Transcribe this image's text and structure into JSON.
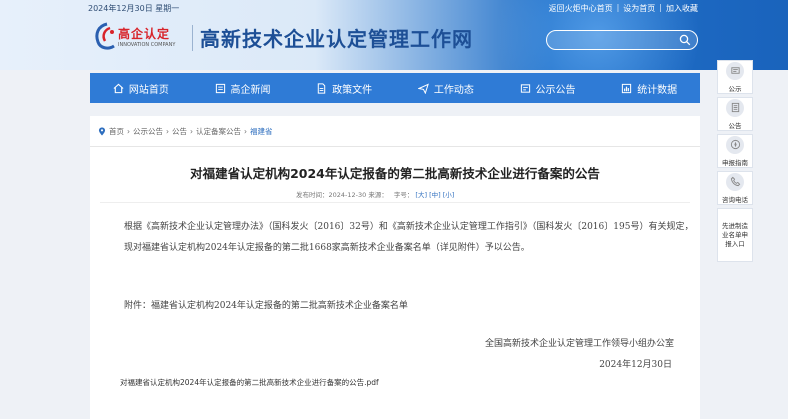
{
  "topbar": {
    "date": "2024年12月30日 星期一",
    "links": [
      "返回火炬中心首页",
      "设为首页",
      "加入收藏"
    ],
    "sep": "|"
  },
  "logo": {
    "cn": "高企认定",
    "en": "INNOVATION COMPANY"
  },
  "site_title": "高新技术企业认定管理工作网",
  "search": {
    "placeholder": ""
  },
  "nav": [
    {
      "label": "网站首页",
      "icon": "home-icon"
    },
    {
      "label": "高企新闻",
      "icon": "news-icon"
    },
    {
      "label": "政策文件",
      "icon": "document-icon"
    },
    {
      "label": "工作动态",
      "icon": "send-icon"
    },
    {
      "label": "公示公告",
      "icon": "notice-icon"
    },
    {
      "label": "统计数据",
      "icon": "chart-icon"
    }
  ],
  "breadcrumb": {
    "items": [
      "首页",
      "公示公告",
      "公告",
      "认定备案公告"
    ],
    "sep": "›",
    "current": "福建省"
  },
  "article": {
    "title": "对福建省认定机构2024年认定报备的第二批高新技术企业进行备案的公告",
    "publish_label": "发布时间：2024-12-30 来源：",
    "size_label": "字号：",
    "size_options": [
      "[大]",
      "[中]",
      "[小]"
    ],
    "paragraph": "根据《高新技术企业认定管理办法》（国科发火〔2016〕32号）和《高新技术企业认定管理工作指引》（国科发火〔2016〕195号）有关规定，现对福建省认定机构2024年认定报备的第二批1668家高新技术企业备案名单（详见附件）予以公告。",
    "attachment_line": "附件：福建省认定机构2024年认定报备的第二批高新技术企业备案名单",
    "signature_org": "全国高新技术企业认定管理工作领导小组办公室",
    "signature_date": "2024年12月30日",
    "pdf_link": "对福建省认定机构2024年认定报备的第二批高新技术企业进行备案的公告.pdf"
  },
  "sidebar": [
    {
      "label": "公示",
      "icon": "notice-board-icon"
    },
    {
      "label": "公告",
      "icon": "announcement-icon"
    },
    {
      "label": "申报指南",
      "icon": "compass-icon"
    },
    {
      "label": "咨询电话",
      "icon": "phone-icon"
    },
    {
      "label": "先进制造业名单申报入口",
      "icon": ""
    }
  ],
  "colors": {
    "nav_bg": "#2f7bd6",
    "title_blue": "#1d4f96",
    "logo_red": "#d8232a",
    "link_blue": "#2f6fbf"
  }
}
